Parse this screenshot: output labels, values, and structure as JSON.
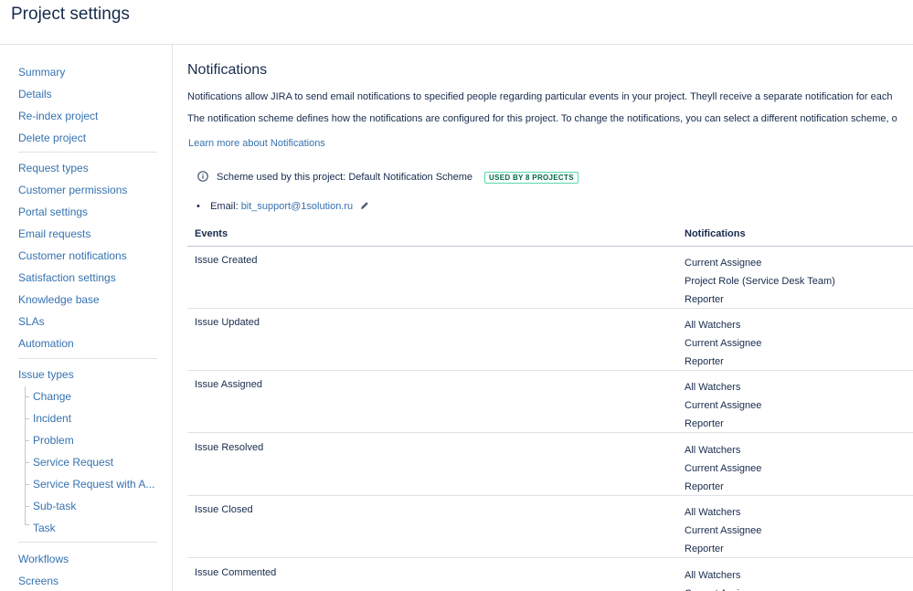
{
  "page": {
    "title": "Project settings"
  },
  "sidebar": {
    "group1": [
      "Summary",
      "Details",
      "Re-index project",
      "Delete project"
    ],
    "group2": [
      "Request types",
      "Customer permissions",
      "Portal settings",
      "Email requests",
      "Customer notifications",
      "Satisfaction settings",
      "Knowledge base",
      "SLAs",
      "Automation"
    ],
    "issue_types": {
      "label": "Issue types",
      "children": [
        "Change",
        "Incident",
        "Problem",
        "Service Request",
        "Service Request with A...",
        "Sub-task",
        "Task"
      ]
    },
    "group4": [
      "Workflows",
      "Screens"
    ]
  },
  "main": {
    "title": "Notifications",
    "para1": "Notifications allow JIRA to send email notifications to specified people regarding particular events in your project. Theyll receive a separate notification for each",
    "para2": "The notification scheme defines how the notifications are configured for this project. To change the notifications, you can select a different notification scheme, o",
    "learn_more": "Learn more about Notifications",
    "scheme": {
      "label": "Scheme used by this project:",
      "name": "Default Notification Scheme",
      "badge": "USED BY 8 PROJECTS"
    },
    "email": {
      "label": "Email:",
      "value": "bit_support@1solution.ru"
    }
  },
  "table": {
    "headers": {
      "events": "Events",
      "notifications": "Notifications"
    },
    "rows": [
      {
        "event": "Issue Created",
        "notifications": [
          "Current Assignee",
          "Project Role (Service Desk Team)",
          "Reporter"
        ]
      },
      {
        "event": "Issue Updated",
        "notifications": [
          "All Watchers",
          "Current Assignee",
          "Reporter"
        ]
      },
      {
        "event": "Issue Assigned",
        "notifications": [
          "All Watchers",
          "Current Assignee",
          "Reporter"
        ]
      },
      {
        "event": "Issue Resolved",
        "notifications": [
          "All Watchers",
          "Current Assignee",
          "Reporter"
        ]
      },
      {
        "event": "Issue Closed",
        "notifications": [
          "All Watchers",
          "Current Assignee",
          "Reporter"
        ]
      },
      {
        "event": "Issue Commented",
        "notifications": [
          "All Watchers",
          "Current Assignee"
        ]
      }
    ]
  },
  "colors": {
    "link": "#3572b0",
    "text": "#172b4d",
    "badge": "#006644",
    "border": "#dfe1e6"
  }
}
